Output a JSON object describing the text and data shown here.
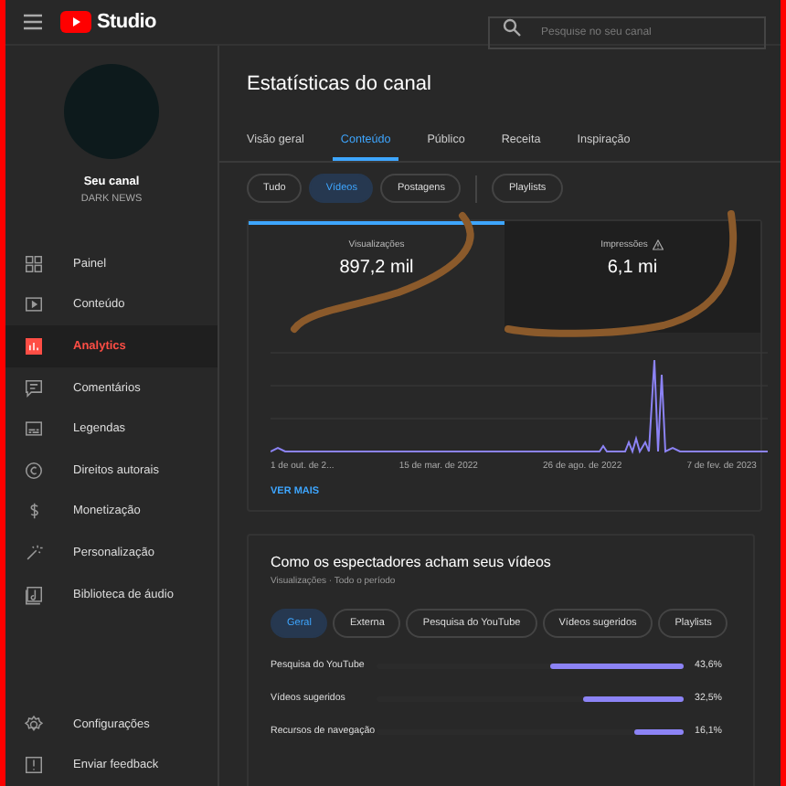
{
  "header": {
    "logo_text": "Studio",
    "search": {
      "placeholder": "Pesquise no seu canal"
    }
  },
  "channel": {
    "title": "Seu canal",
    "name": "DARK NEWS"
  },
  "sidebar": {
    "items": [
      {
        "label": "Painel",
        "kind": "dashboard",
        "selected": false
      },
      {
        "label": "Conteúdo",
        "kind": "content",
        "selected": false
      },
      {
        "label": "Analytics",
        "kind": "analytics",
        "selected": true
      },
      {
        "label": "Comentários",
        "kind": "comments",
        "selected": false
      },
      {
        "label": "Legendas",
        "kind": "subtitles",
        "selected": false
      },
      {
        "label": "Direitos autorais",
        "kind": "copyright",
        "selected": false
      },
      {
        "label": "Monetização",
        "kind": "money",
        "selected": false
      },
      {
        "label": "Personalização",
        "kind": "wand",
        "selected": false
      },
      {
        "label": "Biblioteca de áudio",
        "kind": "audio",
        "selected": false
      }
    ],
    "footer_items": [
      {
        "label": "Configurações",
        "kind": "settings"
      },
      {
        "label": "Enviar feedback",
        "kind": "feedback"
      }
    ]
  },
  "page_title": "Estatísticas do canal",
  "tabs": [
    {
      "label": "Visão geral",
      "selected": false
    },
    {
      "label": "Conteúdo",
      "selected": true
    },
    {
      "label": "Público",
      "selected": false
    },
    {
      "label": "Receita",
      "selected": false
    },
    {
      "label": "Inspiração",
      "selected": false
    }
  ],
  "chips": [
    {
      "label": "Tudo",
      "selected": false
    },
    {
      "label": "Vídeos",
      "selected": true
    },
    {
      "label": "Postagens",
      "selected": false
    },
    {
      "label": "Playlists",
      "selected": false
    }
  ],
  "metrics": [
    {
      "label": "Visualizações",
      "value": "897,2 mil",
      "selected": true,
      "warning": false
    },
    {
      "label": "Impressões",
      "value": "6,1 mi",
      "selected": false,
      "warning": true
    }
  ],
  "chart": {
    "x_labels": [
      "1 de out. de 2...",
      "15 de mar. de 2022",
      "26 de ago. de 2022",
      "7 de fev. de 2023"
    ]
  },
  "see_more": "VER MAIS",
  "discovery": {
    "title": "Como os espectadores acham seus vídeos",
    "subtitle": "Visualizações · Todo o período",
    "chips": [
      {
        "label": "Geral",
        "selected": true
      },
      {
        "label": "Externa",
        "selected": false
      },
      {
        "label": "Pesquisa do YouTube",
        "selected": false
      },
      {
        "label": "Vídeos sugeridos",
        "selected": false
      },
      {
        "label": "Playlists",
        "selected": false
      }
    ],
    "rows": [
      {
        "label": "Pesquisa do YouTube",
        "level": 0.436,
        "reading": "43,6%"
      },
      {
        "label": "Vídeos sugeridos",
        "level": 0.325,
        "reading": "32,5%"
      },
      {
        "label": "Recursos de navegação",
        "level": 0.161,
        "reading": "16,1%"
      }
    ]
  }
}
